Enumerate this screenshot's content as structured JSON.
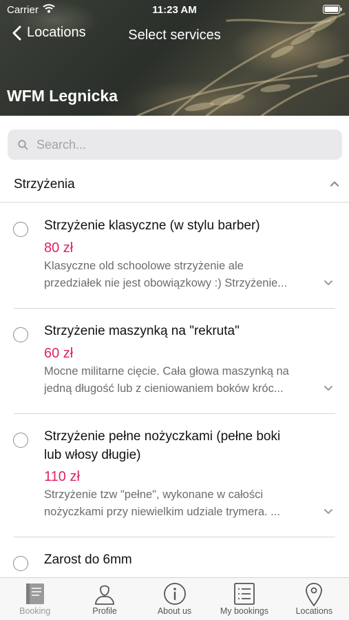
{
  "status_bar": {
    "carrier": "Carrier",
    "time": "11:23 AM"
  },
  "nav": {
    "back_label": "Locations",
    "title": "Select services"
  },
  "salon": {
    "name": "WFM Legnicka"
  },
  "search": {
    "placeholder": "Search..."
  },
  "category": {
    "title": "Strzyżenia",
    "expanded": true
  },
  "services": [
    {
      "name": "Strzyżenie klasyczne (w stylu barber)",
      "price": "80 zł",
      "description_lines": [
        "Klasyczne old schoolowe strzyżenie ale",
        "przedziałek nie jest obowiązkowy :) Strzyżenie..."
      ]
    },
    {
      "name": "Strzyżenie maszynką na \"rekruta\"",
      "price": "60 zł",
      "description_lines": [
        "Mocne militarne cięcie. Cała głowa maszynką na",
        "jedną długość lub z cieniowaniem boków króc..."
      ]
    },
    {
      "name_lines": [
        "Strzyżenie pełne nożyczkami (pełne boki",
        "lub włosy długie)"
      ],
      "price": "110 zł",
      "description_lines": [
        "Strzyżenie tzw \"pełne\", wykonane w całości",
        "nożyczkami przy niewielkim udziale trymera. ..."
      ]
    },
    {
      "name": "Zarost do 6mm"
    }
  ],
  "tabs": [
    {
      "label": "Booking",
      "icon": "book-icon",
      "active": true
    },
    {
      "label": "Profile",
      "icon": "person-icon",
      "active": false
    },
    {
      "label": "About us",
      "icon": "info-icon",
      "active": false
    },
    {
      "label": "My bookings",
      "icon": "list-icon",
      "active": false
    },
    {
      "label": "Locations",
      "icon": "map-pin-icon",
      "active": false
    }
  ],
  "colors": {
    "price": "#e0245e",
    "tab_bar": "#f7f7f7",
    "search_bg": "#e9e9ec"
  }
}
